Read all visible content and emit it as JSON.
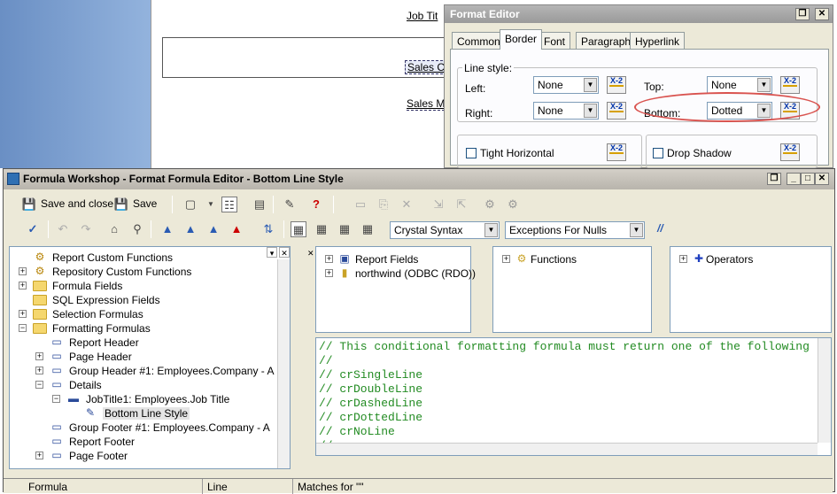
{
  "report": {
    "job_title_field": "Job Tit",
    "sales_field_1": "Sales C",
    "sales_field_2": "Sales M"
  },
  "format_editor": {
    "title": "Format Editor",
    "tabs": [
      "Common",
      "Border",
      "Font",
      "Paragraph",
      "Hyperlink"
    ],
    "active_tab": "Border",
    "line_style_label": "Line style:",
    "left_label": "Left:",
    "left_value": "None",
    "right_label": "Right:",
    "right_value": "None",
    "top_label": "Top:",
    "top_value": "None",
    "bottom_label": "Bottom:",
    "bottom_value": "Dotted",
    "formula_button_label": "X-2",
    "tight_horizontal_label": "Tight Horizontal",
    "drop_shadow_label": "Drop Shadow",
    "highlight_color": "#d9534f"
  },
  "formula_workshop": {
    "title": "Formula Workshop - Format Formula Editor - Bottom Line Style",
    "save_and_close_label": "Save and close",
    "save_label": "Save",
    "syntax_select": "Crystal Syntax",
    "nulls_select": "Exceptions For Nulls",
    "comment_button": "//",
    "tree": [
      {
        "label": "Report Custom Functions",
        "level": 0,
        "icon": "gear-icon",
        "expander": ""
      },
      {
        "label": "Repository Custom Functions",
        "level": 0,
        "icon": "gear-icon",
        "expander": "+"
      },
      {
        "label": "Formula Fields",
        "level": 0,
        "icon": "folder-icon",
        "expander": "+"
      },
      {
        "label": "SQL Expression Fields",
        "level": 0,
        "icon": "folder-icon",
        "expander": ""
      },
      {
        "label": "Selection Formulas",
        "level": 0,
        "icon": "folder-icon",
        "expander": "+"
      },
      {
        "label": "Formatting Formulas",
        "level": 0,
        "icon": "folder-icon",
        "expander": "−"
      },
      {
        "label": "Report Header",
        "level": 1,
        "icon": "section-icon",
        "expander": ""
      },
      {
        "label": "Page Header",
        "level": 1,
        "icon": "section-icon",
        "expander": "+"
      },
      {
        "label": "Group Header #1: Employees.Company - A",
        "level": 1,
        "icon": "section-icon",
        "expander": "+"
      },
      {
        "label": "Details",
        "level": 1,
        "icon": "section-icon",
        "expander": "−"
      },
      {
        "label": "JobTitle1: Employees.Job Title",
        "level": 2,
        "icon": "field-icon",
        "expander": "−"
      },
      {
        "label": "Bottom Line Style",
        "level": 3,
        "icon": "formula-icon",
        "expander": ""
      },
      {
        "label": "Group Footer #1: Employees.Company - A",
        "level": 1,
        "icon": "section-icon",
        "expander": ""
      },
      {
        "label": "Report Footer",
        "level": 1,
        "icon": "section-icon",
        "expander": ""
      },
      {
        "label": "Page Footer",
        "level": 1,
        "icon": "section-icon",
        "expander": "+"
      }
    ],
    "fields_pane": [
      "Report Fields",
      "northwind (ODBC (RDO))"
    ],
    "functions_pane": [
      "Functions"
    ],
    "operators_pane": [
      "Operators"
    ],
    "code_lines": [
      "// This conditional formatting formula must return one of the following",
      "//",
      "// crSingleLine",
      "// crDoubleLine",
      "// crDashedLine",
      "// crDottedLine",
      "// crNoLine",
      "//"
    ],
    "status": {
      "formula": "Formula",
      "line": "Line",
      "matches": "Matches for \"\""
    }
  }
}
